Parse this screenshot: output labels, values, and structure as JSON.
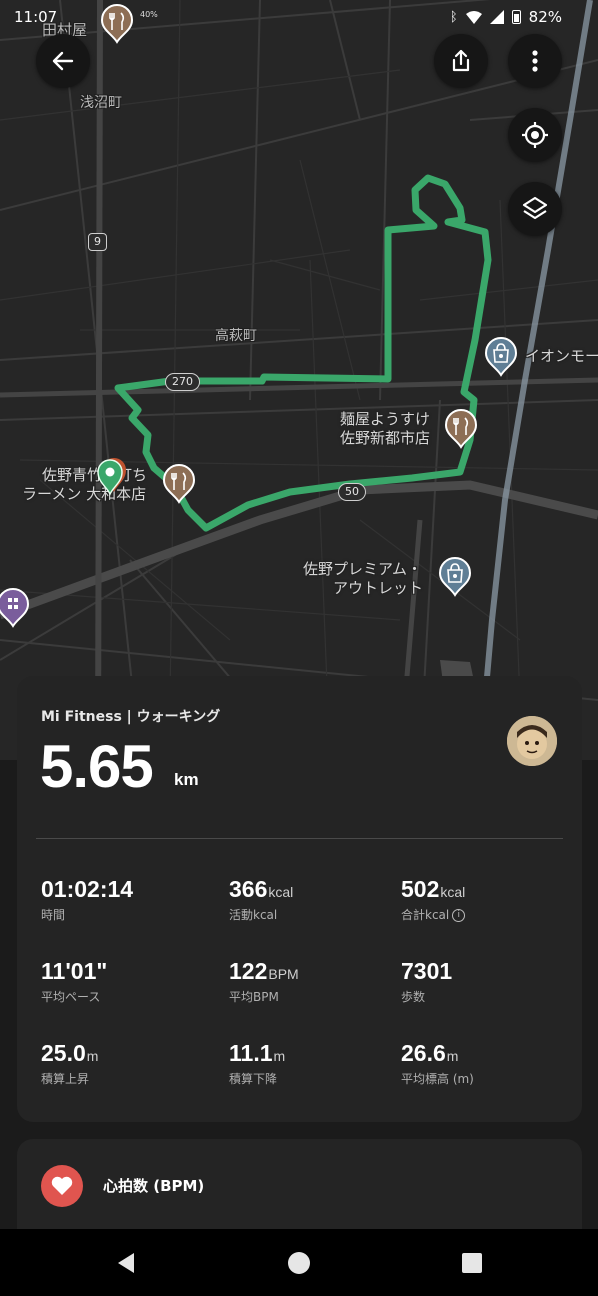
{
  "status_bar": {
    "time": "11:07",
    "extra": "40%",
    "battery": "82%"
  },
  "map": {
    "labels": {
      "asanuma": "浅沼町",
      "takahagi": "高萩町",
      "tamuraya": "田村屋"
    },
    "route_shields": {
      "r9": "9",
      "r270": "270",
      "r50": "50"
    },
    "pois": {
      "menya": [
        "麺屋ようすけ",
        "佐野新都市店"
      ],
      "ramen": [
        "佐野青竹手打ち",
        "ラーメン 大和本店"
      ],
      "outlet": [
        "佐野プレミアム・",
        "アウトレット"
      ],
      "aeon": "イオンモー"
    }
  },
  "card": {
    "source": "Mi Fitness | ウォーキング",
    "distance": "5.65",
    "distance_unit": "km",
    "stats": [
      {
        "value": "01:02:14",
        "unit": "",
        "label": "時間"
      },
      {
        "value": "366",
        "unit": "kcal",
        "label": "活動kcal"
      },
      {
        "value": "502",
        "unit": "kcal",
        "label": "合計kcal"
      },
      {
        "value": "11'01\"",
        "unit": "",
        "label": "平均ペース"
      },
      {
        "value": "122",
        "unit": "BPM",
        "label": "平均BPM"
      },
      {
        "value": "7301",
        "unit": "",
        "label": "歩数"
      },
      {
        "value": "25.0",
        "unit": "m",
        "label": "積算上昇"
      },
      {
        "value": "11.1",
        "unit": "m",
        "label": "積算下降"
      },
      {
        "value": "26.6",
        "unit": "m",
        "label": "平均標高 (m)"
      }
    ]
  },
  "heart_rate": {
    "title": "心拍数 (BPM)"
  },
  "colors": {
    "route": "#3aa76a",
    "background": "#1b1b1b",
    "card": "#242424",
    "heart": "#e0554f"
  },
  "icons": {
    "back": "arrow-left-icon",
    "share": "share-icon",
    "more": "more-vertical-icon",
    "locate": "my-location-icon",
    "layers": "layers-icon"
  }
}
